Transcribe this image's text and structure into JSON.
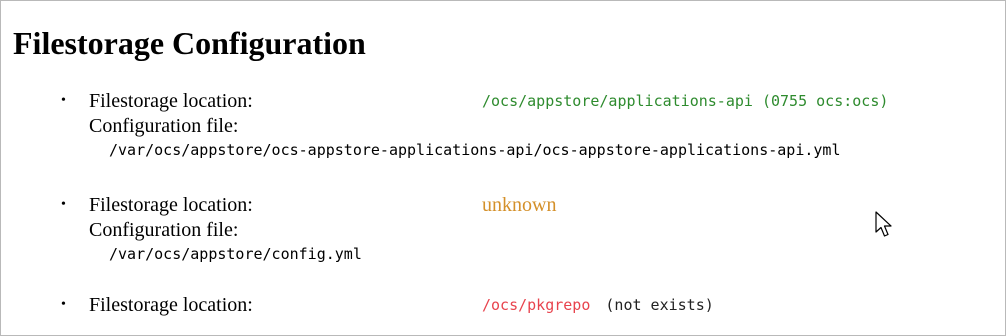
{
  "page": {
    "title": "Filestorage Configuration"
  },
  "entries": [
    {
      "bullet": "•",
      "location_label": "Filestorage location:",
      "location_value": "/ocs/appstore/applications-api (0755 ocs:ocs)",
      "status": "ok",
      "config_label": "Configuration file:",
      "config_path": "/var/ocs/appstore/ocs-appstore-applications-api/ocs-appstore-applications-api.yml"
    },
    {
      "bullet": "•",
      "location_label": "Filestorage location:",
      "location_value": "unknown",
      "status": "warning",
      "config_label": "Configuration file:",
      "config_path": "/var/ocs/appstore/config.yml"
    },
    {
      "bullet": "•",
      "location_label": "Filestorage location:",
      "location_value": "/ocs/pkgrepo",
      "location_note": "(not exists)",
      "status": "error"
    }
  ],
  "colors": {
    "ok": "#2e8b2e",
    "warning": "#d4902a",
    "error": "#e8434d"
  },
  "cursor": {
    "icon": "mouse-pointer-icon"
  }
}
